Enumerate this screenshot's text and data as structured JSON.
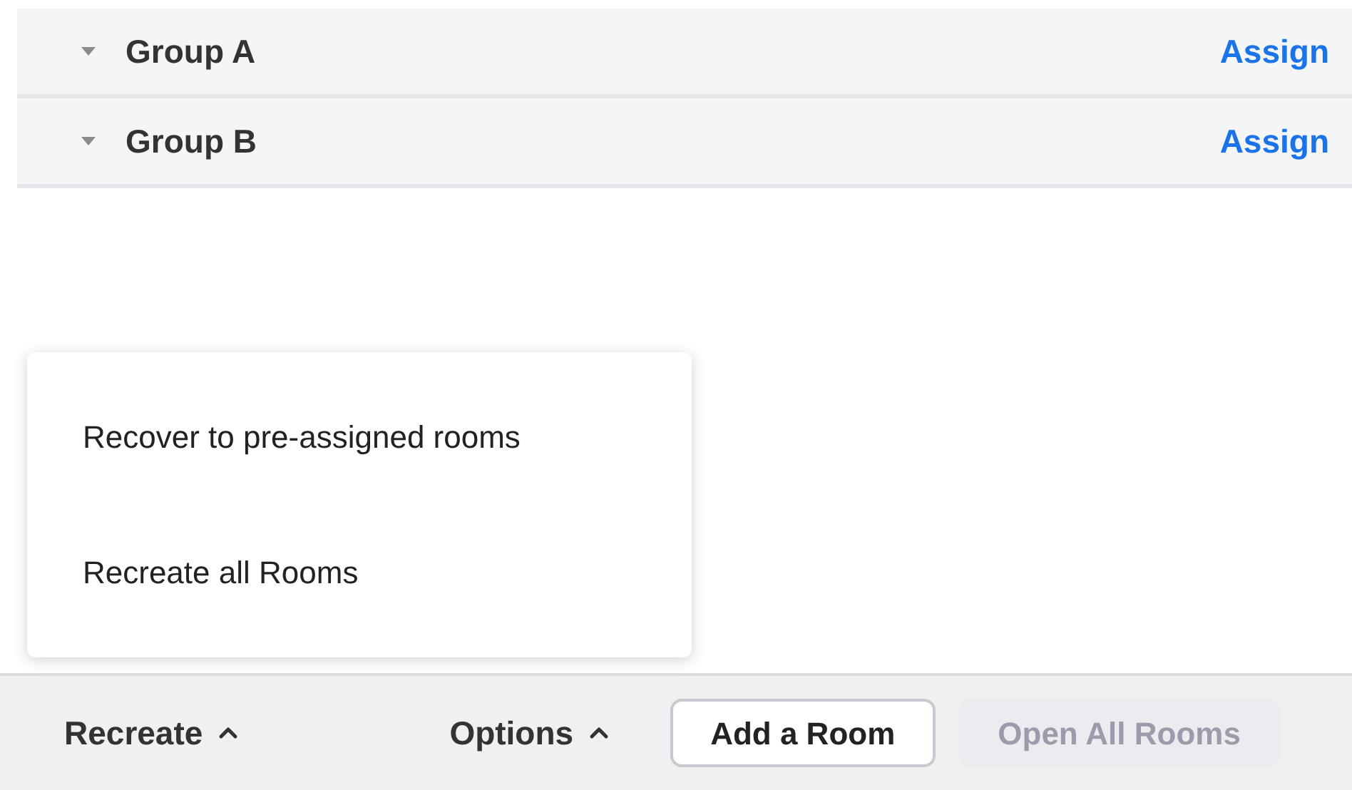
{
  "groups": [
    {
      "name": "Group A",
      "expanded": true,
      "action": "Assign"
    },
    {
      "name": "Group B",
      "expanded": true,
      "action": "Assign"
    }
  ],
  "recreate_menu": {
    "label": "Recreate",
    "open": true,
    "items": [
      "Recover to pre-assigned rooms",
      "Recreate all Rooms"
    ]
  },
  "options_menu": {
    "label": "Options",
    "open": false
  },
  "buttons": [
    {
      "label": "Add a Room",
      "disabled": false
    },
    {
      "label": "Open All Rooms",
      "disabled": true
    }
  ]
}
